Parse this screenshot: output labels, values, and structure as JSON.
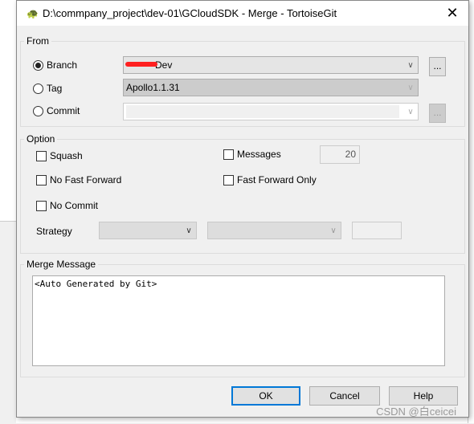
{
  "window": {
    "title": "D:\\commpany_project\\dev-01\\GCloudSDK - Merge - TortoiseGit",
    "close": "✕"
  },
  "from": {
    "legend": "From",
    "branch": {
      "label": "Branch",
      "value": "Dev",
      "selected": true,
      "browse": "..."
    },
    "tag": {
      "label": "Tag",
      "value": "Apollo1.1.31",
      "selected": false
    },
    "commit": {
      "label": "Commit",
      "value": "",
      "selected": false,
      "browse": "..."
    }
  },
  "option": {
    "legend": "Option",
    "squash": "Squash",
    "messages": "Messages",
    "messages_count": "20",
    "no_fast_forward": "No Fast Forward",
    "fast_forward_only": "Fast Forward Only",
    "no_commit": "No Commit",
    "strategy": "Strategy"
  },
  "merge_message": {
    "legend": "Merge Message",
    "value": "<Auto Generated by Git>"
  },
  "buttons": {
    "ok": "OK",
    "cancel": "Cancel",
    "help": "Help"
  },
  "watermark": "CSDN @白ceicei",
  "colors": {
    "accent": "#0078d7",
    "redaction": "#ff2020"
  }
}
